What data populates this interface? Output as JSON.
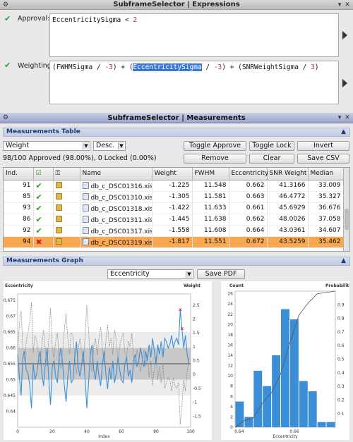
{
  "expressions_window": {
    "title": "SubframeSelector | Expressions",
    "approval_label": "Approval:",
    "approval_expr": {
      "var": "EccentricitySigma",
      "op": " < ",
      "num": "2"
    },
    "weighting_label": "Weighting:",
    "weighting_expr": {
      "p1": "(FWHMSigma / ",
      "n1": "-3",
      "p2": ") + (",
      "sel": "EccentricitySigma",
      "p3": " / ",
      "n2": "-3",
      "p4": ") + (SNRWeightSigma / ",
      "n3": "3",
      "p5": ")"
    }
  },
  "measurements_window": {
    "title": "SubframeSelector | Measurements",
    "table_section": "Measurements Table",
    "sort_field": "Weight",
    "sort_order": "Desc.",
    "status": "98/100 Approved (98.00%), 0 Locked (0.00%)",
    "buttons": {
      "toggle_approve": "Toggle Approve",
      "toggle_lock": "Toggle Lock",
      "invert": "Invert",
      "remove": "Remove",
      "clear": "Clear",
      "save_csv": "Save CSV"
    },
    "columns": [
      "Ind.",
      "",
      "",
      "Name",
      "Weight",
      "FWHM",
      "Eccentricity",
      "SNR Weight",
      "Median"
    ],
    "rows": [
      {
        "ind": "91",
        "approved": true,
        "name": "db_c_DSC01316.xisf",
        "weight": "-1.225",
        "fwhm": "11.548",
        "ecc": "0.662",
        "snr": "41.3166",
        "median": "33.009"
      },
      {
        "ind": "85",
        "approved": true,
        "name": "db_c_DSC01310.xisf",
        "weight": "-1.305",
        "fwhm": "11.581",
        "ecc": "0.663",
        "snr": "46.4772",
        "median": "35.327"
      },
      {
        "ind": "93",
        "approved": true,
        "name": "db_c_DSC01318.xisf",
        "weight": "-1.422",
        "fwhm": "11.633",
        "ecc": "0.661",
        "snr": "45.6929",
        "median": "36.676"
      },
      {
        "ind": "86",
        "approved": true,
        "name": "db_c_DSC01311.xisf",
        "weight": "-1.445",
        "fwhm": "11.638",
        "ecc": "0.662",
        "snr": "48.0026",
        "median": "37.058"
      },
      {
        "ind": "92",
        "approved": true,
        "name": "db_c_DSC01317.xisf",
        "weight": "-1.558",
        "fwhm": "11.608",
        "ecc": "0.664",
        "snr": "43.0361",
        "median": "34.607"
      },
      {
        "ind": "94",
        "approved": false,
        "name": "db_c_DSC01319.xisf",
        "weight": "-1.817",
        "fwhm": "11.551",
        "ecc": "0.672",
        "snr": "43.5259",
        "median": "35.462"
      }
    ],
    "graph_section": "Measurements Graph",
    "graph_property": "Eccentricity",
    "save_pdf": "Save PDF"
  },
  "chart_data": [
    {
      "type": "line",
      "title": "",
      "ylabel": "Eccentricity",
      "y2label": "Weight",
      "xlabel": "Index",
      "xlim": [
        0,
        100
      ],
      "ylim": [
        0.635,
        0.677
      ],
      "y2lim": [
        -1.9,
        2.9
      ],
      "x_ticks": [
        "0",
        "20",
        "40",
        "60",
        "80",
        "100"
      ],
      "y_ticks": [
        "0.64",
        "0.645",
        "0.65",
        "0.655",
        "0.66",
        "0.665",
        "0.67",
        "0.675"
      ],
      "y2_ticks": [
        "-1.5",
        "-1",
        "-0.5",
        "0",
        "0.5",
        "1",
        "1.5",
        "2",
        "2.5"
      ],
      "median": 0.655,
      "band_inner": [
        0.65,
        0.66
      ],
      "band_outer": [
        0.645,
        0.665
      ],
      "series": [
        {
          "name": "Eccentricity",
          "color": "#3a8fd8",
          "values": [
            0.658,
            0.651,
            0.645,
            0.657,
            0.659,
            0.653,
            0.652,
            0.648,
            0.641,
            0.655,
            0.65,
            0.652,
            0.656,
            0.659,
            0.652,
            0.648,
            0.655,
            0.66,
            0.65,
            0.642,
            0.654,
            0.656,
            0.651,
            0.649,
            0.657,
            0.66,
            0.655,
            0.648,
            0.643,
            0.651,
            0.656,
            0.649,
            0.65,
            0.657,
            0.662,
            0.654,
            0.651,
            0.655,
            0.659,
            0.65,
            0.641,
            0.649,
            0.658,
            0.661,
            0.653,
            0.65,
            0.656,
            0.651,
            0.648,
            0.655,
            0.659,
            0.652,
            0.647,
            0.654,
            0.65,
            0.656,
            0.649,
            0.652,
            0.657,
            0.653,
            0.65,
            0.649,
            0.655,
            0.657,
            0.651,
            0.653,
            0.649,
            0.656,
            0.658,
            0.654,
            0.656,
            0.66,
            0.657,
            0.654,
            0.659,
            0.656,
            0.661,
            0.657,
            0.663,
            0.659,
            0.655,
            0.661,
            0.658,
            0.662,
            0.657,
            0.663,
            0.662,
            0.66,
            0.661,
            0.664,
            0.66,
            0.662,
            0.663,
            0.661,
            0.672,
            0.666,
            0.66,
            0.664,
            0.658,
            0.655
          ]
        },
        {
          "name": "Weight",
          "color": "#888888",
          "values": [
            0.9,
            1.8,
            2.3,
            1.0,
            0.5,
            1.2,
            1.5,
            1.9,
            2.6,
            0.8,
            1.4,
            1.2,
            0.7,
            0.4,
            1.1,
            1.6,
            0.9,
            0.3,
            1.3,
            2.4,
            1.0,
            0.6,
            1.2,
            1.5,
            0.6,
            0.2,
            0.8,
            1.6,
            2.2,
            1.3,
            0.7,
            1.5,
            1.4,
            0.6,
            0.0,
            0.9,
            1.3,
            0.8,
            0.4,
            1.4,
            2.5,
            1.6,
            0.5,
            0.1,
            1.0,
            1.3,
            0.7,
            1.3,
            1.7,
            0.9,
            0.4,
            1.2,
            1.8,
            1.0,
            1.3,
            0.7,
            1.6,
            1.3,
            0.5,
            1.0,
            1.3,
            1.5,
            0.8,
            0.6,
            1.2,
            1.0,
            1.5,
            0.6,
            0.4,
            0.9,
            0.6,
            0.1,
            0.5,
            0.9,
            0.3,
            0.7,
            -0.1,
            0.5,
            -0.4,
            0.2,
            0.6,
            -0.2,
            0.3,
            -0.3,
            0.4,
            -0.5,
            -0.3,
            -0.1,
            -0.2,
            -0.6,
            -0.1,
            -0.4,
            -0.5,
            -0.3,
            -1.8,
            -1.1,
            -0.2,
            -0.6,
            0.1,
            0.6
          ]
        }
      ],
      "markers": [
        {
          "x": 94,
          "y": 0.672
        },
        {
          "x": 95,
          "y": 0.666
        }
      ]
    },
    {
      "type": "bar",
      "title": "",
      "xlabel": "Eccentricity",
      "ylabel": "Count",
      "y2label": "Probability",
      "ylim": [
        0,
        26.5
      ],
      "y2lim": [
        0,
        1
      ],
      "x_ticks": [
        "0.64",
        "0.66"
      ],
      "y_ticks": [
        "0",
        "2",
        "4",
        "6",
        "8",
        "10",
        "12",
        "14",
        "16",
        "18",
        "20",
        "22",
        "24",
        "26"
      ],
      "y2_ticks": [
        "0.1",
        "0.2",
        "0.3",
        "0.4",
        "0.5",
        "0.6",
        "0.7",
        "0.8",
        "0.9"
      ],
      "bin_edges": [
        0.6385,
        0.6418,
        0.6451,
        0.6484,
        0.6517,
        0.655,
        0.6583,
        0.6616,
        0.6649,
        0.6682,
        0.6715,
        0.6748
      ],
      "values": [
        5,
        2,
        11,
        8,
        14,
        23,
        21,
        9,
        7,
        1,
        1
      ],
      "color": "#3a8fd8",
      "cdf_color": "#555555"
    }
  ]
}
